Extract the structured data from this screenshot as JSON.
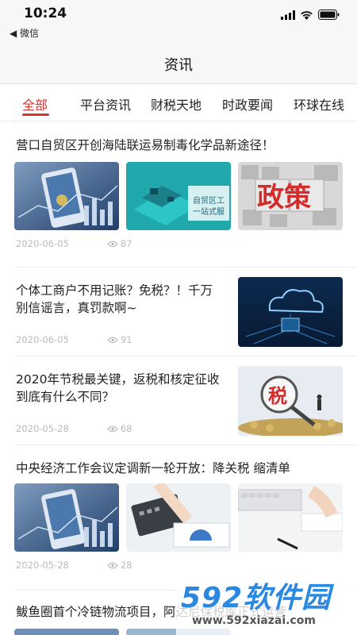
{
  "status": {
    "time": "10:24",
    "back_label": "◀ 微信"
  },
  "nav": {
    "title": "资讯"
  },
  "tabs": [
    "全部",
    "平台资讯",
    "财税天地",
    "时政要闻",
    "环球在线"
  ],
  "articles": [
    {
      "title": "营口自贸区开创海陆联运易制毒化学品新途径！",
      "date": "2020-06-05",
      "views": "87",
      "thumb_texts": [
        "自贸区工",
        "一站式服",
        "政策"
      ]
    },
    {
      "title": "个体工商户不用记账？免税？！千万别信谣言，真罚款啊~",
      "date": "2020-06-05",
      "views": "91"
    },
    {
      "title": "2020年节税最关键，返税和核定征收到底有什么不同？",
      "date": "2020-05-28",
      "views": "68",
      "thumb_texts": [
        "税"
      ]
    },
    {
      "title": "中央经济工作会议定调新一轮开放：降关税 缩清单",
      "date": "2020-05-28",
      "views": "28"
    },
    {
      "title": "鲅鱼圈首个冷链物流项目，阿达尼保税库正式运营",
      "date": "",
      "views": ""
    }
  ],
  "watermark": {
    "logo": "592软件园",
    "url": "www.592xiazai.com"
  }
}
